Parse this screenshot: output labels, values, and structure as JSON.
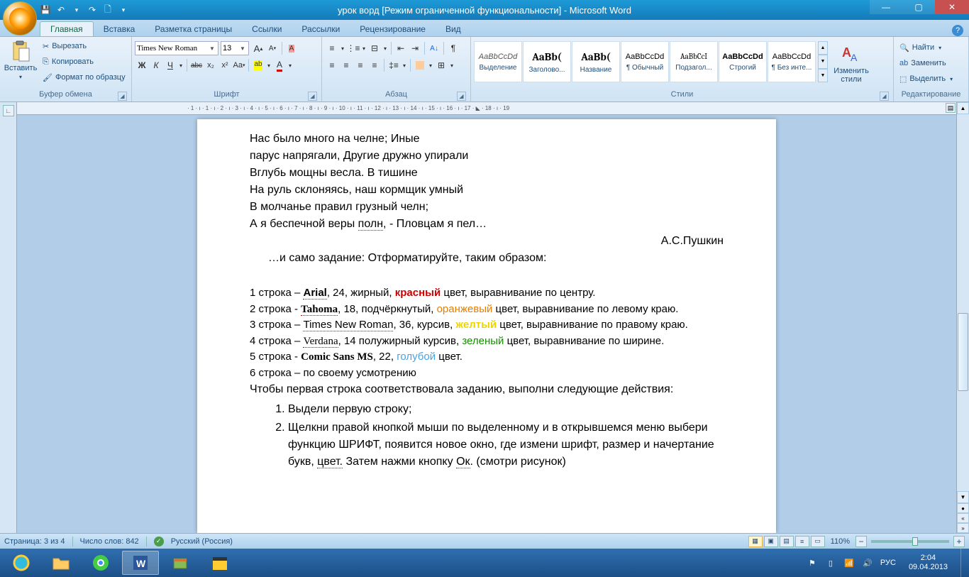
{
  "window": {
    "title": "урок ворд [Режим ограниченной функциональности] - Microsoft Word"
  },
  "qat": {
    "save": "💾",
    "undo": "↶",
    "redo": "↷",
    "new": "🗋",
    "down": "▾"
  },
  "tabs": [
    "Главная",
    "Вставка",
    "Разметка страницы",
    "Ссылки",
    "Рассылки",
    "Рецензирование",
    "Вид"
  ],
  "clipboard": {
    "paste": "Вставить",
    "cut": "Вырезать",
    "copy": "Копировать",
    "format_painter": "Формат по образцу",
    "group": "Буфер обмена"
  },
  "font": {
    "name": "Times New Roman",
    "size": "13",
    "group": "Шрифт",
    "bold": "Ж",
    "italic": "К",
    "underline": "Ч",
    "strike": "abc",
    "sub": "x₂",
    "sup": "x²",
    "case": "Aa",
    "grow": "A",
    "shrink": "A",
    "clear": "Aa",
    "highlight": "ab",
    "color": "A"
  },
  "paragraph": {
    "group": "Абзац"
  },
  "styles": {
    "group": "Стили",
    "items": [
      {
        "preview": "AaBbCcDd",
        "name": "Выделение",
        "style": "font-style:italic;color:#555;font-size:11px"
      },
      {
        "preview": "AaBb(",
        "name": "Заголово...",
        "style": "font-weight:bold;font-family:Cambria;font-size:15px"
      },
      {
        "preview": "AaBb(",
        "name": "Название",
        "style": "font-weight:bold;font-family:Cambria;font-size:15px"
      },
      {
        "preview": "AaBbCcDd",
        "name": "¶ Обычный",
        "style": "font-size:11px"
      },
      {
        "preview": "AaBbCcI",
        "name": "Подзагол...",
        "style": "font-family:Cambria;font-size:11px"
      },
      {
        "preview": "AaBbCcDd",
        "name": "Строгий",
        "style": "font-weight:bold;font-size:11px"
      },
      {
        "preview": "AaBbCcDd",
        "name": "¶ Без инте...",
        "style": "font-size:11px"
      }
    ],
    "change": "Изменить\nстили"
  },
  "editing": {
    "group": "Редактирование",
    "find": "Найти",
    "replace": "Заменить",
    "select": "Выделить"
  },
  "ruler_marks": "· 1 · ı · 1 · ı · 2 · ı · 3 · ı · 4 · ı · 5 · ı · 6 · ı · 7 · ı · 8 · ı · 9 · ı · 10 · ı · 11 · ı · 12 · ı · 13 · ı · 14 · ı · 15 · ı · 16 · ı · 17 · ◣ · 18 · ı · 19",
  "doc": {
    "poem": [
      "Нас было много на челне; Иные",
      "парус напрягали, Другие дружно упирали",
      "Вглубь мощны весла. В тишине",
      "На руль склоняясь, наш кормщик умный",
      "В молчанье правил грузный челн;",
      "А я беспечной веры полн,  - Пловцам я пел…"
    ],
    "author": "А.С.Пушкин",
    "task_intro": "…и само задание: Отформатируйте, таким образом:",
    "fmt": {
      "l1a": "1 строка – ",
      "l1b": "Arial",
      "l1c": ", 24, жирный, ",
      "l1d": "красный",
      "l1e": " цвет, выравнивание по центру.",
      "l2a": "2 строка - ",
      "l2b": "Tahoma",
      "l2c": ", 18, подчёркнутый, ",
      "l2d": "оранжевый",
      "l2e": " цвет, выравнивание по левому краю.",
      "l3a": "3 строка – ",
      "l3b": "Times New Roman",
      "l3c": ", 36, курсив, ",
      "l3d": "желтый",
      "l3e": " цвет, выравнивание по правому краю.",
      "l4a": "4 строка – ",
      "l4b": "Verdana",
      "l4c": ", 14 полужирный курсив, ",
      "l4d": "зеленый",
      "l4e": " цвет, выравнивание по ширине.",
      "l5a": "5 строка - ",
      "l5b": "Comic Sans MS",
      "l5c": ", 22,  ",
      "l5d": "голубой",
      "l5e": " цвет.",
      "l6": "6 строка – по своему усмотрению"
    },
    "instr_head": "Чтобы первая строка соответствовала заданию, выполни следующие действия:",
    "step1": "Выдели первую строку;",
    "step2": "Щелкни правой кнопкой мыши по выделенному и в открывшемся меню выбери функцию ШРИФТ, появится новое окно, где измени шрифт, размер и начертание букв, цвет. Затем нажми кнопку Ок. (смотри рисунок)"
  },
  "status": {
    "page": "Страница: 3 из 4",
    "words": "Число слов: 842",
    "lang": "Русский (Россия)",
    "zoom": "110%"
  },
  "tray": {
    "lang": "РУС",
    "time": "2:04",
    "date": "09.04.2013"
  }
}
